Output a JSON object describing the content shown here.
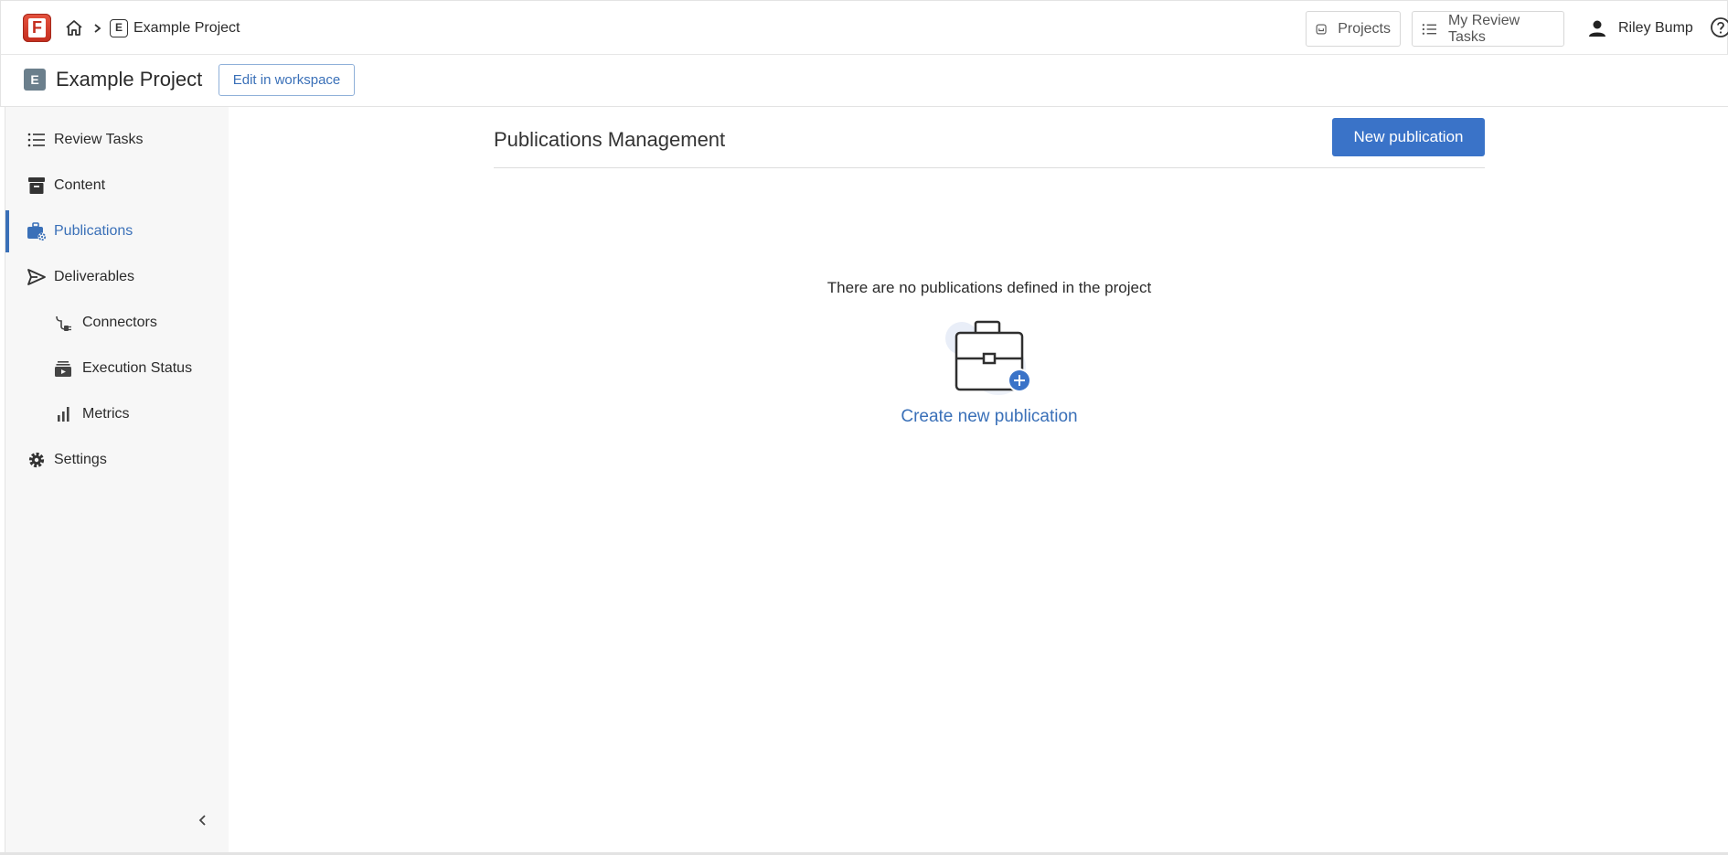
{
  "topbar": {
    "logo_letter": "F",
    "breadcrumb": {
      "badge": "E",
      "project": "Example Project"
    },
    "projects_label": "Projects",
    "tasks_label": "My Review Tasks",
    "user_name": "Riley Bump"
  },
  "project": {
    "badge": "E",
    "title": "Example Project",
    "edit_label": "Edit in workspace"
  },
  "sidebar": {
    "items": [
      {
        "label": "Review Tasks",
        "icon": "list-icon"
      },
      {
        "label": "Content",
        "icon": "archive-icon"
      },
      {
        "label": "Publications",
        "icon": "briefcase-gear-icon",
        "active": true
      },
      {
        "label": "Deliverables",
        "icon": "send-icon"
      },
      {
        "label": "Connectors",
        "icon": "plug-icon"
      },
      {
        "label": "Execution Status",
        "icon": "video-stack-icon"
      },
      {
        "label": "Metrics",
        "icon": "bar-chart-icon"
      },
      {
        "label": "Settings",
        "icon": "gear-icon"
      }
    ]
  },
  "main": {
    "title": "Publications Management",
    "new_button": "New publication",
    "empty_message": "There are no publications defined in the project",
    "create_link": "Create new publication"
  },
  "colors": {
    "accent": "#3a70b8",
    "primary_button": "#3a73c8",
    "logo": "#c42e1f"
  }
}
